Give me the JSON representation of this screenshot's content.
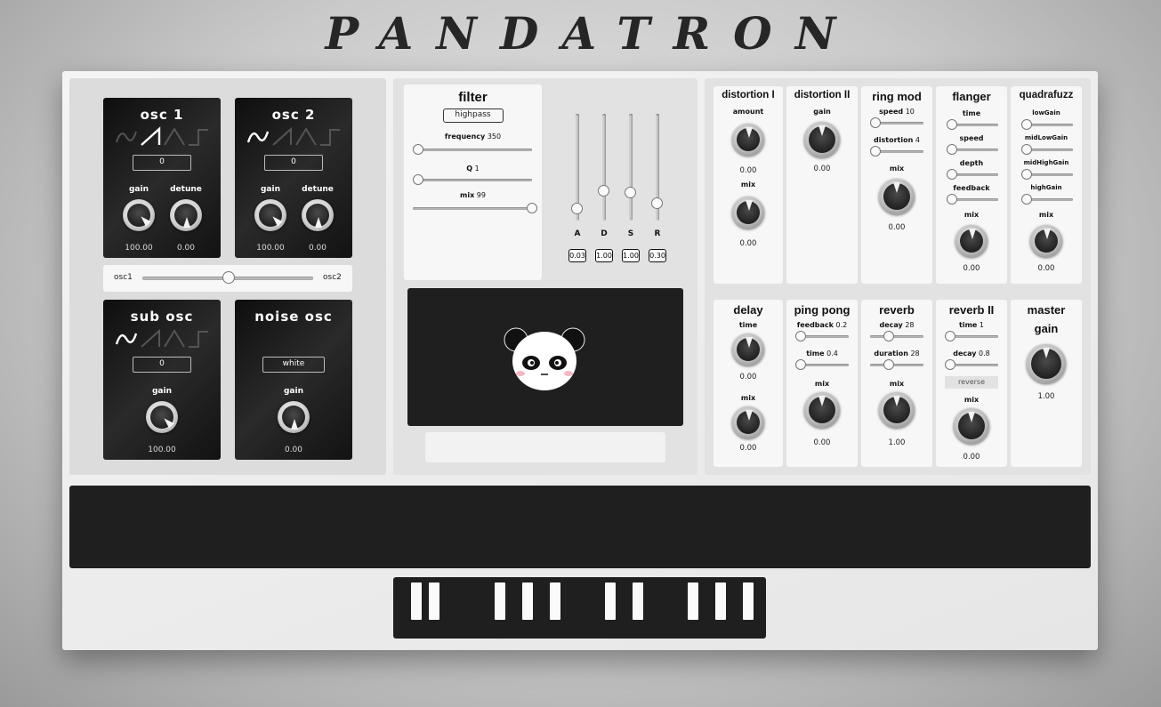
{
  "app": {
    "title": "PANDATRON"
  },
  "oscillators": {
    "osc1": {
      "title": "osc 1",
      "value": "0",
      "gain_label": "gain",
      "detune_label": "detune",
      "gain": "100.00",
      "detune": "0.00"
    },
    "osc2": {
      "title": "osc 2",
      "value": "0",
      "gain_label": "gain",
      "detune_label": "detune",
      "gain": "100.00",
      "detune": "0.00"
    },
    "mix": {
      "left": "osc1",
      "right": "osc2",
      "position": 0.5
    },
    "sub": {
      "title": "sub osc",
      "value": "0",
      "gain_label": "gain",
      "gain": "100.00"
    },
    "noise": {
      "title": "noise osc",
      "value": "white",
      "gain_label": "gain",
      "gain": "0.00"
    }
  },
  "filter": {
    "title": "filter",
    "type": "highpass",
    "frequency_label": "frequency",
    "frequency": "350",
    "q_label": "Q",
    "q": "1",
    "mix_label": "mix",
    "mix": "99"
  },
  "adsr": {
    "labels": [
      "A",
      "D",
      "S",
      "R"
    ],
    "values": [
      "0.03",
      "1.00",
      "1.00",
      "0.30"
    ],
    "levels": [
      0.0,
      0.25,
      0.25,
      0.1
    ]
  },
  "effects": {
    "distortion1": {
      "title": "distortion I",
      "amount_label": "amount",
      "amount": "0.00",
      "mix_label": "mix",
      "mix": "0.00"
    },
    "distortion2": {
      "title": "distortion II",
      "gain_label": "gain",
      "gain": "0.00"
    },
    "ringmod": {
      "title": "ring mod",
      "speed_label": "speed",
      "speed": "10",
      "distortion_label": "distortion",
      "distortion": "4",
      "mix_label": "mix",
      "mix": "0.00"
    },
    "flanger": {
      "title": "flanger",
      "time_label": "time",
      "speed_label": "speed",
      "depth_label": "depth",
      "feedback_label": "feedback",
      "mix_label": "mix",
      "mix": "0.00"
    },
    "quadrafuzz": {
      "title": "quadrafuzz",
      "low_label": "lowGain",
      "midlow_label": "midLowGain",
      "midhigh_label": "midHighGain",
      "high_label": "highGain",
      "mix_label": "mix",
      "mix": "0.00"
    },
    "delay": {
      "title": "delay",
      "time_label": "time",
      "time": "0.00",
      "mix_label": "mix",
      "mix": "0.00"
    },
    "pingpong": {
      "title": "ping pong",
      "feedback_label": "feedback",
      "feedback": "0.2",
      "time_label": "time",
      "time": "0.4",
      "mix_label": "mix",
      "mix": "0.00"
    },
    "reverb": {
      "title": "reverb",
      "decay_label": "decay",
      "decay": "28",
      "duration_label": "duration",
      "duration": "28",
      "mix_label": "mix",
      "mix": "1.00"
    },
    "reverb2": {
      "title": "reverb II",
      "time_label": "time",
      "time": "1",
      "decay_label": "decay",
      "decay": "0.8",
      "reverse_label": "reverse",
      "mix_label": "mix",
      "mix": "0.00"
    },
    "master": {
      "title": "master",
      "gain_label": "gain",
      "gain": "1.00"
    }
  },
  "colors": {
    "dark": "#1f1f1f",
    "panel": "#dcdcdc",
    "card": "#f7f7f7"
  }
}
